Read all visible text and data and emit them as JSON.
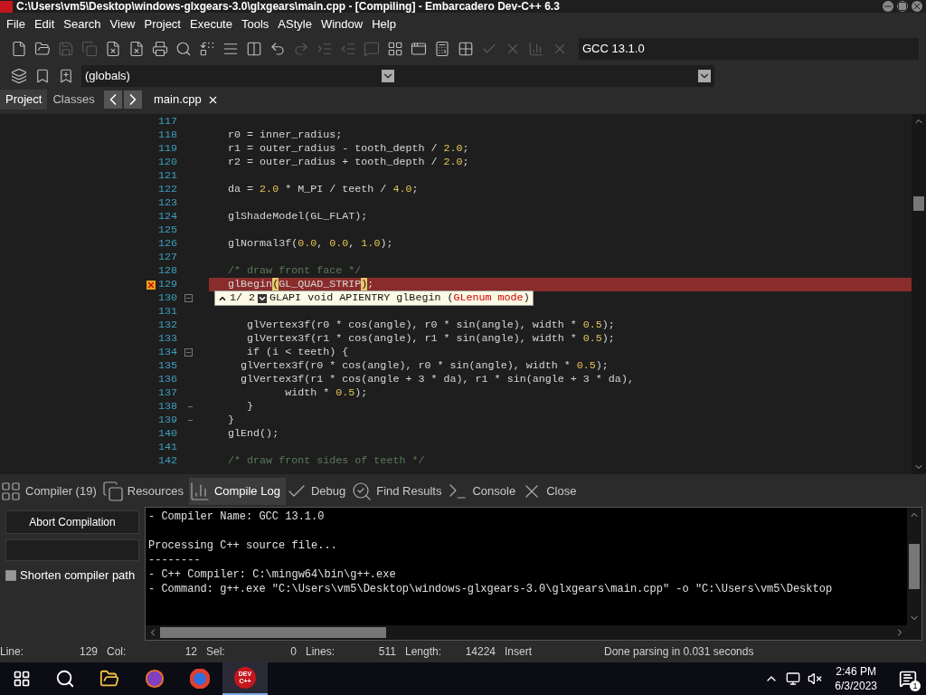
{
  "window": {
    "title": "C:\\Users\\vm5\\Desktop\\windows-glxgears-3.0\\glxgears\\main.cpp - [Compiling] - Embarcadero Dev-C++ 6.3"
  },
  "menu": [
    "File",
    "Edit",
    "Search",
    "View",
    "Project",
    "Execute",
    "Tools",
    "AStyle",
    "Window",
    "Help"
  ],
  "compiler_select": "GCC 13.1.0",
  "scope_select": "(globals)",
  "left_tabs": [
    {
      "label": "Project",
      "selected": true
    },
    {
      "label": "Classes",
      "selected": false
    }
  ],
  "file_tabs": [
    {
      "label": "main.cpp",
      "selected": true
    }
  ],
  "editor": {
    "lines": [
      {
        "no": "117",
        "error": false
      },
      {
        "no": "118",
        "error": false,
        "segs": [
          {
            "t": "   r0 = inner_radius;",
            "kind": "plain"
          }
        ]
      },
      {
        "no": "119",
        "error": false,
        "segs": [
          {
            "t": "   r1 = outer_radius - tooth_depth / ",
            "kind": "plain"
          },
          {
            "t": "2.0",
            "kind": "num"
          },
          {
            "t": ";",
            "kind": "plain"
          }
        ]
      },
      {
        "no": "120",
        "error": false,
        "segs": [
          {
            "t": "   r2 = outer_radius + tooth_depth / ",
            "kind": "plain"
          },
          {
            "t": "2.0",
            "kind": "num"
          },
          {
            "t": ";",
            "kind": "plain"
          }
        ]
      },
      {
        "no": "121",
        "error": false
      },
      {
        "no": "122",
        "error": false,
        "segs": [
          {
            "t": "   da = ",
            "kind": "plain"
          },
          {
            "t": "2.0",
            "kind": "num"
          },
          {
            "t": " * M_PI / teeth / ",
            "kind": "plain"
          },
          {
            "t": "4.0",
            "kind": "num"
          },
          {
            "t": ";",
            "kind": "plain"
          }
        ]
      },
      {
        "no": "123",
        "error": false
      },
      {
        "no": "124",
        "error": false,
        "segs": [
          {
            "t": "   glShadeModel(GL_FLAT);",
            "kind": "plain"
          }
        ]
      },
      {
        "no": "125",
        "error": false
      },
      {
        "no": "126",
        "error": false,
        "segs": [
          {
            "t": "   glNormal3f(",
            "kind": "plain"
          },
          {
            "t": "0.0",
            "kind": "num"
          },
          {
            "t": ", ",
            "kind": "plain"
          },
          {
            "t": "0.0",
            "kind": "num"
          },
          {
            "t": ", ",
            "kind": "plain"
          },
          {
            "t": "1.0",
            "kind": "num"
          },
          {
            "t": ");",
            "kind": "plain"
          }
        ]
      },
      {
        "no": "127",
        "error": false
      },
      {
        "no": "128",
        "error": false,
        "segs": [
          {
            "t": "   /* draw front face */",
            "kind": "comment"
          }
        ]
      },
      {
        "no": "129",
        "error": true,
        "segs": [
          {
            "t": "   glBegin",
            "kind": "plain"
          },
          {
            "t": "(",
            "kind": "bracket"
          },
          {
            "t": "GL_QUAD_STRIP",
            "kind": "plain"
          },
          {
            "t": ")",
            "kind": "bracket"
          },
          {
            "t": ";",
            "kind": "plain"
          }
        ]
      },
      {
        "no": "130",
        "error": false,
        "kind": "fold_start"
      },
      {
        "no": "131",
        "error": false
      },
      {
        "no": "132",
        "error": false,
        "segs": [
          {
            "t": "      glVertex3f(r0 * cos(angle), r0 * sin(angle), width * ",
            "kind": "plain"
          },
          {
            "t": "0.5",
            "kind": "num"
          },
          {
            "t": ");",
            "kind": "plain"
          }
        ]
      },
      {
        "no": "133",
        "error": false,
        "segs": [
          {
            "t": "      glVertex3f(r1 * cos(angle), r1 * sin(angle), width * ",
            "kind": "plain"
          },
          {
            "t": "0.5",
            "kind": "num"
          },
          {
            "t": ");",
            "kind": "plain"
          }
        ]
      },
      {
        "no": "134",
        "error": false,
        "kind": "fold_start",
        "segs": [
          {
            "t": "      if (i < teeth) {",
            "kind": "plain"
          }
        ]
      },
      {
        "no": "135",
        "error": false,
        "segs": [
          {
            "t": "     glVertex3f(r0 * cos(angle), r0 * sin(angle), width * ",
            "kind": "plain"
          },
          {
            "t": "0.5",
            "kind": "num"
          },
          {
            "t": ");",
            "kind": "plain"
          }
        ]
      },
      {
        "no": "136",
        "error": false,
        "segs": [
          {
            "t": "     glVertex3f(r1 * cos(angle + 3 * da), r1 * sin(angle + 3 * da),",
            "kind": "plain"
          }
        ]
      },
      {
        "no": "137",
        "error": false,
        "segs": [
          {
            "t": "            width * ",
            "kind": "plain"
          },
          {
            "t": "0.5",
            "kind": "num"
          },
          {
            "t": ");",
            "kind": "plain"
          }
        ]
      },
      {
        "no": "138",
        "error": false,
        "kind": "fold_end",
        "segs": [
          {
            "t": "      }",
            "kind": "plain"
          }
        ]
      },
      {
        "no": "139",
        "error": false,
        "kind": "fold_end",
        "segs": [
          {
            "t": "   }",
            "kind": "plain"
          }
        ]
      },
      {
        "no": "140",
        "error": false,
        "segs": [
          {
            "t": "   glEnd();",
            "kind": "plain"
          }
        ]
      },
      {
        "no": "141",
        "error": false
      },
      {
        "no": "142",
        "error": false,
        "segs": [
          {
            "t": "   /* draw front sides of teeth */",
            "kind": "comment"
          }
        ]
      }
    ],
    "tooltip": {
      "counter": "1/ 2",
      "segs": [
        {
          "t": "GLAPI void APIENTRY glBegin (",
          "kind": "plain"
        },
        {
          "t": "GLenum mode",
          "kind": "param"
        },
        {
          "t": ")",
          "kind": "plain"
        }
      ]
    }
  },
  "bottom_tabs": [
    {
      "label": "Compiler (19)",
      "selected": false
    },
    {
      "label": "Resources",
      "selected": false
    },
    {
      "label": "Compile Log",
      "selected": true
    },
    {
      "label": "Debug",
      "selected": false
    },
    {
      "label": "Find Results",
      "selected": false
    },
    {
      "label": "Console",
      "selected": false
    },
    {
      "label": "Close",
      "selected": false
    }
  ],
  "abort_button": "Abort Compilation",
  "shorten_path": {
    "label": "Shorten compiler path",
    "checked": false
  },
  "log_paragraphs": [
    [
      "- Compiler Name: GCC 13.1.0"
    ],
    [
      "Processing C++ source file...",
      "--------",
      "- C++ Compiler: C:\\mingw64\\bin\\g++.exe",
      "- Command: g++.exe \"C:\\Users\\vm5\\Desktop\\windows-glxgears-3.0\\glxgears\\main.cpp\" -o \"C:\\Users\\vm5\\Desktop"
    ]
  ],
  "status_bar": {
    "fields": [
      {
        "label": "Line:",
        "value": "129"
      },
      {
        "label": "Col:",
        "value": "12"
      },
      {
        "label": "Sel:",
        "value": "0"
      },
      {
        "label": "Lines:",
        "value": "511"
      },
      {
        "label": "Length:",
        "value": "14224"
      }
    ],
    "mode": "Insert",
    "message": "Done parsing in 0.031 seconds"
  },
  "taskbar": {
    "devcpp_icon_text": "DEV C++",
    "time": "2:46 PM",
    "date": "6/3/2023",
    "notifications": "1"
  }
}
